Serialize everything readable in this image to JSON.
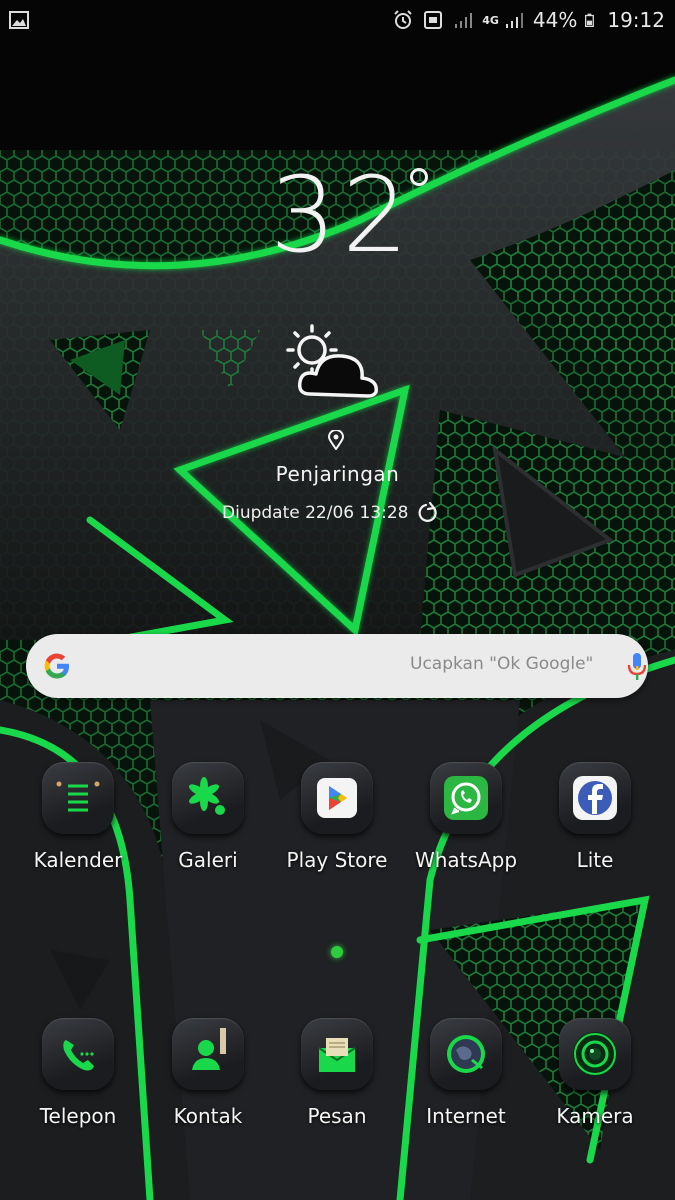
{
  "status_bar": {
    "left_icons": [
      "gallery-notification-icon"
    ],
    "right_icons": [
      "alarm-icon",
      "hd-volte-icon",
      "signal-icon",
      "4g-icon",
      "signal-icon-2",
      "battery-icon"
    ],
    "network": "4G",
    "battery": "44%",
    "time": "19:12"
  },
  "weather": {
    "temperature": "32",
    "condition_icon": "partly-sunny-icon",
    "location": "Penjaringan",
    "updated": "Diupdate 22/06 13:28"
  },
  "search": {
    "placeholder": "Ucapkan \"Ok Google\""
  },
  "apps_row1": [
    {
      "label": "Kalender",
      "icon": "calendar-icon"
    },
    {
      "label": "Galeri",
      "icon": "gallery-icon"
    },
    {
      "label": "Play Store",
      "icon": "play-store-icon"
    },
    {
      "label": "WhatsApp",
      "icon": "whatsapp-icon"
    },
    {
      "label": "Lite",
      "icon": "facebook-lite-icon"
    }
  ],
  "dock": [
    {
      "label": "Telepon",
      "icon": "phone-icon"
    },
    {
      "label": "Kontak",
      "icon": "contacts-icon"
    },
    {
      "label": "Pesan",
      "icon": "messages-icon"
    },
    {
      "label": "Internet",
      "icon": "internet-icon"
    },
    {
      "label": "Kamera",
      "icon": "camera-icon"
    }
  ],
  "colors": {
    "accent_green": "#19d94a",
    "background": "#050705"
  }
}
